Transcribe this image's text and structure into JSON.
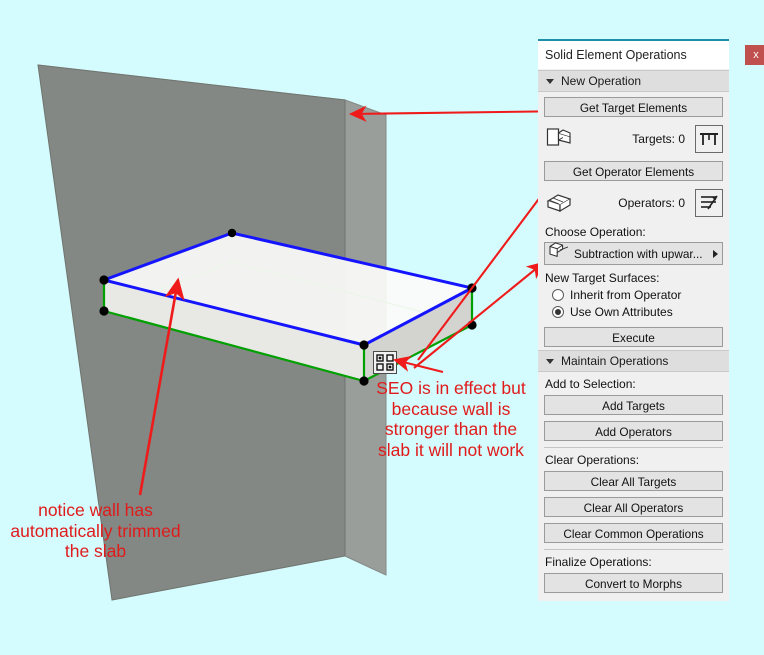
{
  "canvas": {
    "background_color": "#d4fbfd",
    "wall_color": "#838884",
    "wall_top_color": "#e8e6e0",
    "slab_top_color": "#f4f4f2",
    "slab_side_color": "#d6d6d2",
    "highlight_edge_color": "#1414ff",
    "operator_edge_color": "#00a000",
    "node_color": "#000000",
    "annotation_color": "#e01b1b"
  },
  "annotations": {
    "seo_note": "SEO is in effect but because wall is stronger than the slab it will not work",
    "trim_note": "notice wall has automatically trimmed the slab",
    "badge_icon": "seo-badge-icon"
  },
  "palette": {
    "title": "Solid Element Operations",
    "close_label": "x",
    "accent_color": "#1e8fa8",
    "sections": [
      {
        "id": "new-operation",
        "header": "New Operation",
        "expanded": true,
        "get_target_label": "Get Target Elements",
        "targets_count_label": "Targets: 0",
        "targets_icon": "target-solid-icon",
        "targets_action_icon": "select-targets-icon",
        "get_operator_label": "Get Operator Elements",
        "operators_count_label": "Operators: 0",
        "operators_icon": "operator-solid-icon",
        "operators_action_icon": "select-operators-icon",
        "choose_operation_label": "Choose Operation:",
        "operation_value": "Subtraction with upwar...",
        "operation_icon": "subtraction-upward-icon",
        "new_target_surfaces_label": "New Target Surfaces:",
        "radio_options": [
          {
            "label": "Inherit from Operator",
            "selected": false
          },
          {
            "label": "Use Own Attributes",
            "selected": true
          }
        ],
        "execute_label": "Execute"
      },
      {
        "id": "maintain-operations",
        "header": "Maintain Operations",
        "expanded": true,
        "add_to_selection_label": "Add to Selection:",
        "add_targets_label": "Add Targets",
        "add_operators_label": "Add Operators",
        "clear_operations_label": "Clear Operations:",
        "clear_all_targets_label": "Clear All Targets",
        "clear_all_operators_label": "Clear All Operators",
        "clear_common_operations_label": "Clear Common Operations",
        "finalize_operations_label": "Finalize Operations:",
        "convert_to_morphs_label": "Convert to Morphs"
      }
    ]
  }
}
